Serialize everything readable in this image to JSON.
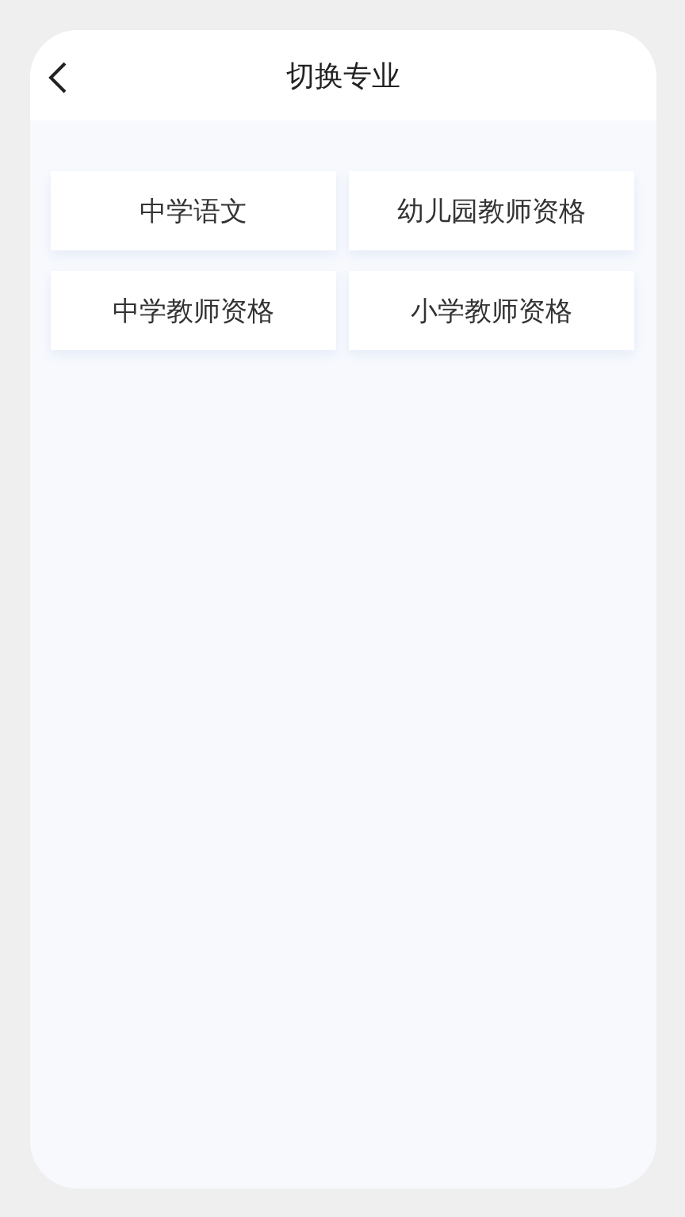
{
  "header": {
    "title": "切换专业"
  },
  "majors": [
    {
      "label": "中学语文"
    },
    {
      "label": "幼儿园教师资格"
    },
    {
      "label": "中学教师资格"
    },
    {
      "label": "小学教师资格"
    }
  ]
}
